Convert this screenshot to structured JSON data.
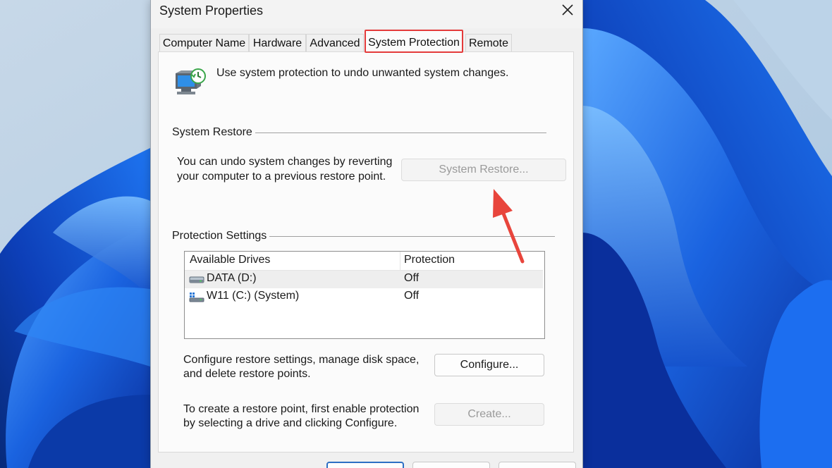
{
  "window": {
    "title": "System Properties",
    "tabs": [
      {
        "label": "Computer Name",
        "active": false
      },
      {
        "label": "Hardware",
        "active": false
      },
      {
        "label": "Advanced",
        "active": false
      },
      {
        "label": "System Protection",
        "active": true
      },
      {
        "label": "Remote",
        "active": false
      }
    ]
  },
  "intro": {
    "text": "Use system protection to undo unwanted system changes.",
    "icon": "system-protection-icon"
  },
  "system_restore": {
    "group_label": "System Restore",
    "description_line1": "You can undo system changes by reverting",
    "description_line2": "your computer to a previous restore point.",
    "button_label": "System Restore...",
    "button_enabled": false
  },
  "protection_settings": {
    "group_label": "Protection Settings",
    "columns": [
      "Available Drives",
      "Protection"
    ],
    "drives": [
      {
        "name": "DATA (D:)",
        "protection": "Off",
        "icon": "hard-drive-icon",
        "selected": true
      },
      {
        "name": "W11 (C:) (System)",
        "protection": "Off",
        "icon": "system-drive-icon",
        "selected": false
      }
    ],
    "configure_text_line1": "Configure restore settings, manage disk space,",
    "configure_text_line2": "and delete restore points.",
    "configure_button": "Configure...",
    "create_text_line1": "To create a restore point, first enable protection",
    "create_text_line2": "by selecting a drive and clicking Configure.",
    "create_button": "Create...",
    "create_enabled": false
  },
  "colors": {
    "highlight": "#e43b3b",
    "arrow": "#e8453c",
    "wallpaper_base": "#bcd3e8",
    "wallpaper_bloom": "#1758d6"
  }
}
